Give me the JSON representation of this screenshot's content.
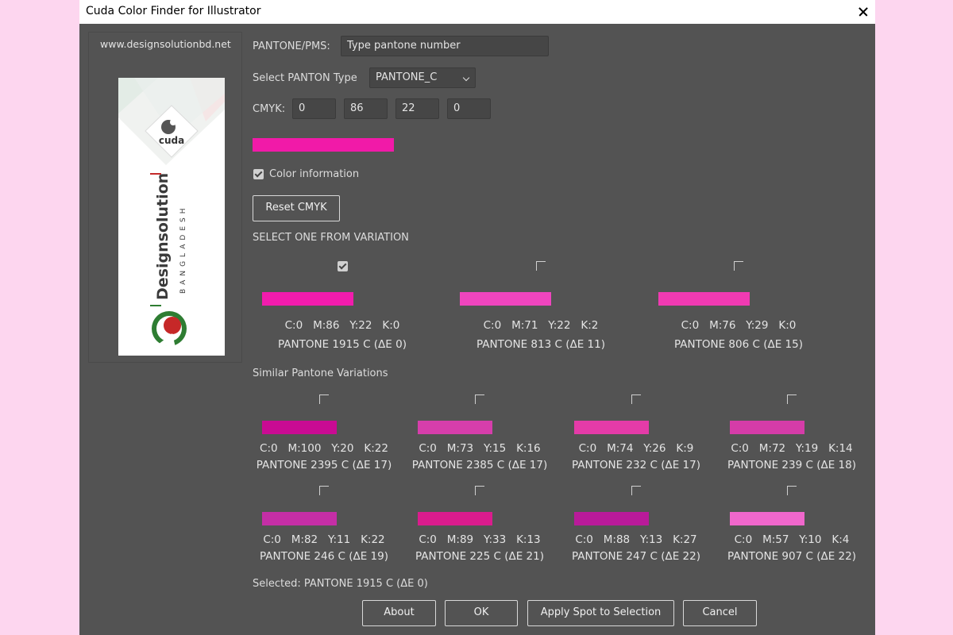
{
  "window": {
    "title": "Cuda Color Finder for Illustrator"
  },
  "sidebar": {
    "website": "www.designsolutionbd.net",
    "logo_brand": "cuda",
    "logo_name": "Designsolution",
    "logo_country": "BANGLADESH"
  },
  "form": {
    "pantone_label": "PANTONE/PMS:",
    "pantone_placeholder": "Type pantone number",
    "type_label": "Select PANTON Type",
    "type_value": "PANTONE_C",
    "cmyk_label": "CMYK:",
    "cmyk_values": [
      "0",
      "86",
      "22",
      "0"
    ],
    "current_color": "#f11aa8",
    "color_info_label": "Color information",
    "color_info_checked": true,
    "reset_label": "Reset CMYK"
  },
  "variation": {
    "heading": "SELECT ONE FROM VARIATION",
    "items": [
      {
        "cmyk": "C:0   M:86   Y:22   K:0",
        "name": "PANTONE 1915 C (ΔE 0)",
        "color": "#f21cad",
        "checked": true
      },
      {
        "cmyk": "C:0   M:71   Y:22   K:2",
        "name": "PANTONE 813 C (ΔE 11)",
        "color": "#ef45be",
        "checked": false
      },
      {
        "cmyk": "C:0   M:76   Y:29   K:0",
        "name": "PANTONE 806 C (ΔE 15)",
        "color": "#f03ab2",
        "checked": false
      }
    ]
  },
  "similar": {
    "heading": "Similar Pantone Variations",
    "items": [
      {
        "cmyk": "C:0   M:100   Y:20   K:22",
        "name": "PANTONE 2395 C (ΔE 17)",
        "color": "#c90b93",
        "checked": false
      },
      {
        "cmyk": "C:0   M:73   Y:15   K:16",
        "name": "PANTONE 2385 C (ΔE 17)",
        "color": "#d63eab",
        "checked": false
      },
      {
        "cmyk": "C:0   M:74   Y:26   K:9",
        "name": "PANTONE 232 C (ΔE 17)",
        "color": "#e43ba8",
        "checked": false
      },
      {
        "cmyk": "C:0   M:72   Y:19   K:14",
        "name": "PANTONE 239 C (ΔE 18)",
        "color": "#d53ca8",
        "checked": false
      },
      {
        "cmyk": "C:0   M:82   Y:11   K:22",
        "name": "PANTONE 246 C (ΔE 19)",
        "color": "#c52ea6",
        "checked": false
      },
      {
        "cmyk": "C:0   M:89   Y:33   K:13",
        "name": "PANTONE 225 C (ΔE 21)",
        "color": "#da1c8d",
        "checked": false
      },
      {
        "cmyk": "C:0   M:88   Y:13   K:27",
        "name": "PANTONE 247 C (ΔE 22)",
        "color": "#b91a9a",
        "checked": false
      },
      {
        "cmyk": "C:0   M:57   Y:10   K:4",
        "name": "PANTONE 907 C (ΔE 22)",
        "color": "#f067cc",
        "checked": false
      }
    ]
  },
  "footer": {
    "selected_text": "Selected: PANTONE 1915 C (ΔE 0)",
    "about_label": "About",
    "ok_label": "OK",
    "apply_label": "Apply Spot to Selection",
    "cancel_label": "Cancel"
  }
}
